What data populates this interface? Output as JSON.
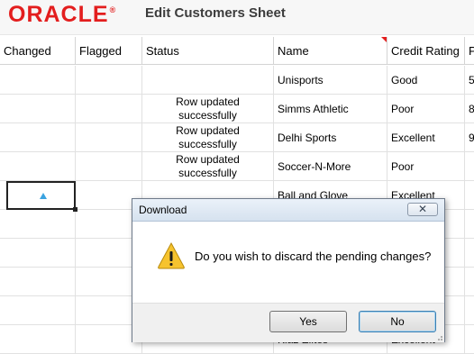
{
  "header": {
    "logo_text": "ORACLE",
    "logo_tm": "®",
    "title": "Edit Customers Sheet"
  },
  "columns": [
    "Changed",
    "Flagged",
    "Status",
    "Name",
    "Credit Rating",
    "P"
  ],
  "rows": [
    {
      "changed": "",
      "flagged": "",
      "status": "",
      "name": "Unisports",
      "credit": "Good",
      "extra": "5"
    },
    {
      "changed": "",
      "flagged": "",
      "status": "Row updated successfully",
      "name": "Simms Athletic",
      "credit": "Poor",
      "extra": "8"
    },
    {
      "changed": "",
      "flagged": "",
      "status": "Row updated successfully",
      "name": "Delhi Sports",
      "credit": "Excellent",
      "extra": "9"
    },
    {
      "changed": "",
      "flagged": "",
      "status": "Row updated successfully",
      "name": "Soccer-N-More",
      "credit": "Poor",
      "extra": ""
    },
    {
      "changed": "▲",
      "flagged": "",
      "status": "",
      "name": "Ball and Glove",
      "credit": "Excellent",
      "extra": ""
    },
    {
      "changed": "",
      "flagged": "",
      "status": "",
      "name": "",
      "credit": "",
      "extra": ""
    },
    {
      "changed": "",
      "flagged": "",
      "status": "",
      "name": "",
      "credit": "",
      "extra": ""
    },
    {
      "changed": "",
      "flagged": "",
      "status": "",
      "name": "",
      "credit": "",
      "extra": ""
    },
    {
      "changed": "",
      "flagged": "",
      "status": "",
      "name": "",
      "credit": "",
      "extra": ""
    },
    {
      "changed": "",
      "flagged": "",
      "status": "",
      "name": "Kiaz Elites",
      "credit": "Excellent",
      "extra": ""
    }
  ],
  "dialog": {
    "title": "Download",
    "close_label": "✕",
    "message": "Do you wish to discard the pending changes?",
    "yes_label": "Yes",
    "no_label": "No",
    "icon": "warning-icon"
  },
  "colors": {
    "brand": "#e31e1e",
    "selection_marker": "#3ba3e0"
  }
}
